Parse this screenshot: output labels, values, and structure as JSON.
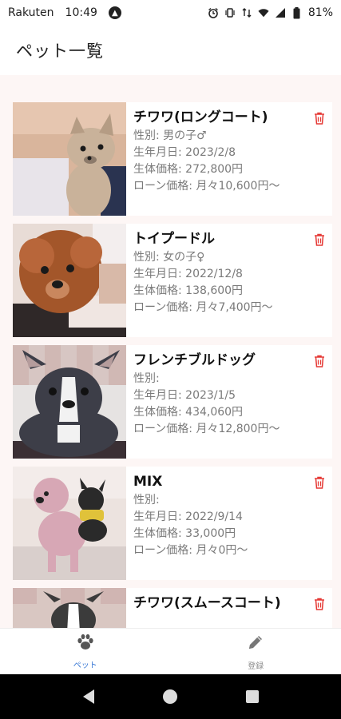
{
  "status_bar": {
    "carrier": "Rakuten",
    "time": "10:49",
    "battery": "81%"
  },
  "header": {
    "title": "ペット一覧"
  },
  "pets": [
    {
      "name": "チワワ(ロングコート)",
      "gender": "性別: 男の子♂",
      "birth": "生年月日: 2023/2/8",
      "price": "生体価格: 272,800円",
      "loan": "ローン価格: 月々10,600円〜",
      "photo_colors": [
        "#c9b29a",
        "#8c7a6a",
        "#e8e4ea"
      ]
    },
    {
      "name": "トイプードル",
      "gender": "性別: 女の子♀",
      "birth": "生年月日: 2022/12/8",
      "price": "生体価格: 138,600円",
      "loan": "ローン価格: 月々7,400円〜",
      "photo_colors": [
        "#a3562a",
        "#d8b9a8",
        "#f0e6e2"
      ]
    },
    {
      "name": "フレンチブルドッグ",
      "gender": "性別:",
      "birth": "生年月日: 2023/1/5",
      "price": "生体価格: 434,060円",
      "loan": "ローン価格: 月々12,800円〜",
      "photo_colors": [
        "#3d3e48",
        "#f2f2f2",
        "#c9a9a6"
      ]
    },
    {
      "name": "MIX",
      "gender": "性別:",
      "birth": "生年月日: 2022/9/14",
      "price": "生体価格: 33,000円",
      "loan": "ローン価格: 月々0円〜",
      "photo_colors": [
        "#d7a7b5",
        "#ece3df",
        "#2a2a2a"
      ]
    },
    {
      "name": "チワワ(スムースコート)",
      "gender": "",
      "birth": "",
      "price": "",
      "loan": "",
      "photo_colors": [
        "#d9c7c2",
        "#3b3b3b",
        "#ffffff"
      ]
    }
  ],
  "bottom_nav": {
    "items": [
      {
        "label": "ペット",
        "icon": "paw-icon",
        "active": true
      },
      {
        "label": "登録",
        "icon": "pencil-icon",
        "active": false
      }
    ]
  },
  "colors": {
    "accent": "#3d7bd6",
    "delete": "#e53935",
    "content_bg": "#fdf6f5",
    "text_secondary": "#7a7a7a"
  }
}
